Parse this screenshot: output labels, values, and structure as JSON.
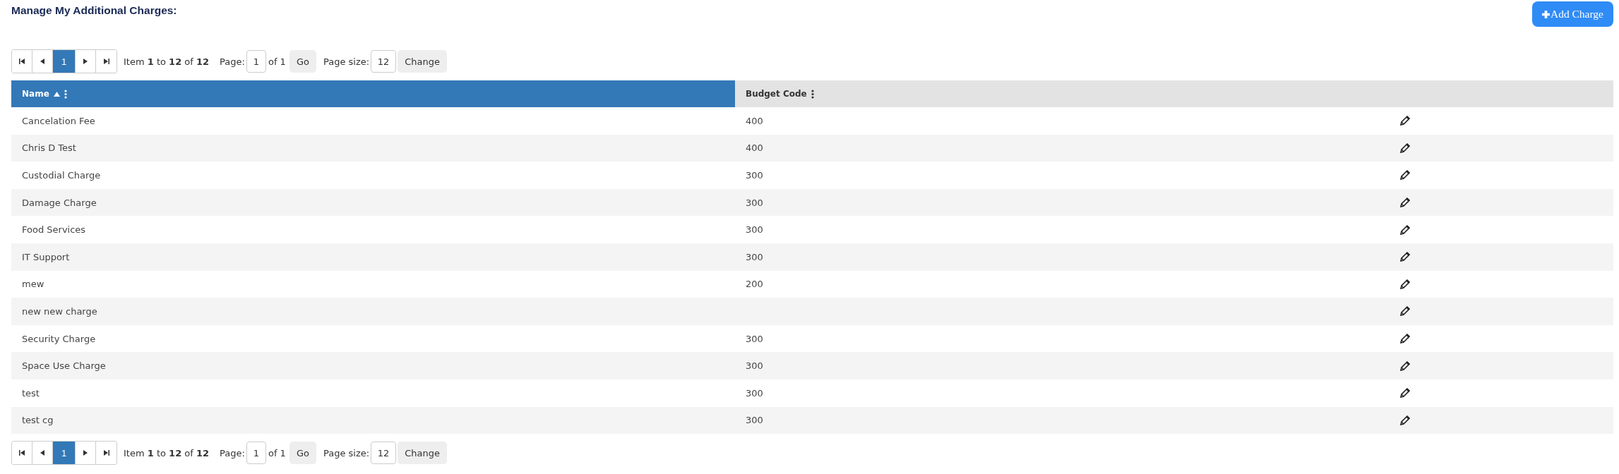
{
  "title": "Manage My Additional Charges:",
  "add_button": {
    "label": "Add Charge"
  },
  "pager_top": {
    "pages": [
      {
        "label": "1",
        "selected": true
      }
    ],
    "summary": "Item **1** to **12** of **12**",
    "page_label": "Page:",
    "page_value": "1",
    "page_of": "of 1",
    "go": "Go",
    "size_label": "Page size:",
    "size_value": "12",
    "change": "Change"
  },
  "table": {
    "columns": [
      {
        "label": "Name",
        "sorted": true,
        "selected": true
      },
      {
        "label": "Budget Code",
        "sorted": false,
        "selected": false
      }
    ],
    "rows": [
      {
        "name": "Cancelation Fee",
        "budget_code": "400"
      },
      {
        "name": "Chris D Test",
        "budget_code": "400"
      },
      {
        "name": "Custodial Charge",
        "budget_code": "300"
      },
      {
        "name": "Damage Charge",
        "budget_code": "300"
      },
      {
        "name": "Food Services",
        "budget_code": "300"
      },
      {
        "name": "IT Support",
        "budget_code": "300"
      },
      {
        "name": "mew",
        "budget_code": "200"
      },
      {
        "name": "new new charge"
      },
      {
        "name": "Security Charge",
        "budget_code": "300"
      },
      {
        "name": "Space Use Charge",
        "budget_code": "300"
      },
      {
        "name": "test",
        "budget_code": "300"
      },
      {
        "name": "test cg",
        "budget_code": "300"
      }
    ]
  },
  "pager_bottom": {
    "pages": [
      {
        "label": "1",
        "selected": true
      }
    ],
    "summary": "Item **1** to **12** of **12**",
    "page_label": "Page:",
    "page_value": "1",
    "page_of": "of 1",
    "go": "Go",
    "size_label": "Page size:",
    "size_value": "12",
    "change": "Change"
  }
}
